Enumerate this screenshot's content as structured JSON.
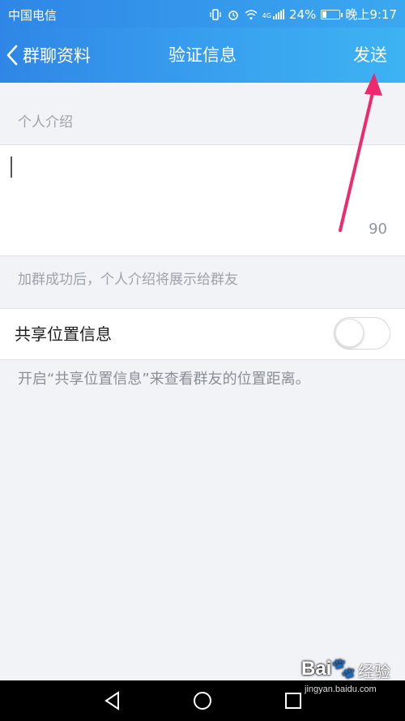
{
  "status_bar": {
    "carrier": "中国电信",
    "signal_type": "4G",
    "battery": "24%",
    "battery_level": 0.24,
    "time": "晚上9:17"
  },
  "title_bar": {
    "back_label": "群聊资料",
    "title": "验证信息",
    "send_label": "发送"
  },
  "intro": {
    "section_label": "个人介绍",
    "value": "",
    "char_count": "90",
    "hint": "加群成功后，个人介绍将展示给群友"
  },
  "share_location": {
    "label": "共享位置信息",
    "enabled": false,
    "description": "开启“共享位置信息”来查看群友的位置距离。"
  },
  "annotation": {
    "color": "#f0286e"
  },
  "watermark": {
    "logo": "Bai🐾",
    "text": "经验",
    "url": "jingyan.baidu.com"
  },
  "colors": {
    "header_start": "#2f86e6",
    "header_end": "#3db3f2",
    "background": "#f2f3f7"
  }
}
